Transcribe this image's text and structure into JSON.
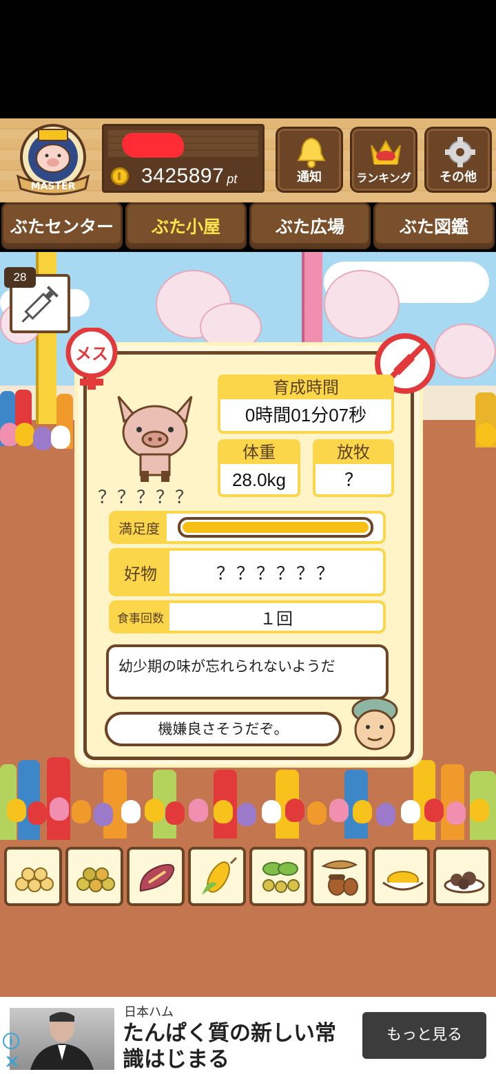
{
  "header": {
    "badge_label": "MASTER",
    "points_value": "3425897",
    "points_unit": "pt",
    "buttons": [
      {
        "label": "通知",
        "icon": "bell-icon"
      },
      {
        "label": "ランキング",
        "icon": "crown-icon"
      },
      {
        "label": "その他",
        "icon": "gear-icon"
      }
    ]
  },
  "nav": {
    "tabs": [
      {
        "label": "ぶたセンター",
        "active": false
      },
      {
        "label": "ぶた小屋",
        "active": true
      },
      {
        "label": "ぶた広場",
        "active": false
      },
      {
        "label": "ぶた図鑑",
        "active": false
      }
    ]
  },
  "syringe": {
    "count": "28"
  },
  "pig": {
    "gender_label": "メス",
    "name": "？？？？？",
    "stats": {
      "growth_time_label": "育成時間",
      "growth_time_value": "0時間01分07秒",
      "weight_label": "体重",
      "weight_value": "28.0kg",
      "pasture_label": "放牧",
      "pasture_value": "？"
    },
    "satisfaction_label": "満足度",
    "satisfaction_level": 1.0,
    "favorite_label": "好物",
    "favorite_value": "？？？？？？",
    "meals_label": "食事回数",
    "meals_value": "１回",
    "message_1": "幼少期の味が忘れられないようだ",
    "message_2": "機嫌良さそうだぞ。"
  },
  "foods": [
    "soybeans-icon",
    "mixed-beans-icon",
    "sweet-potato-icon",
    "corn-icon",
    "leaves-icon",
    "acorn-icon",
    "grain-bowl-icon",
    "meat-plate-icon"
  ],
  "ad": {
    "brand": "日本ハム",
    "headline": "たんぱく質の新しい常識はじまる",
    "button_label": "もっと見る"
  },
  "colors": {
    "accent_yellow": "#fbd54a",
    "wood_dark": "#6b4526",
    "ground": "#c4764f",
    "gender_red": "#e23a3a"
  }
}
